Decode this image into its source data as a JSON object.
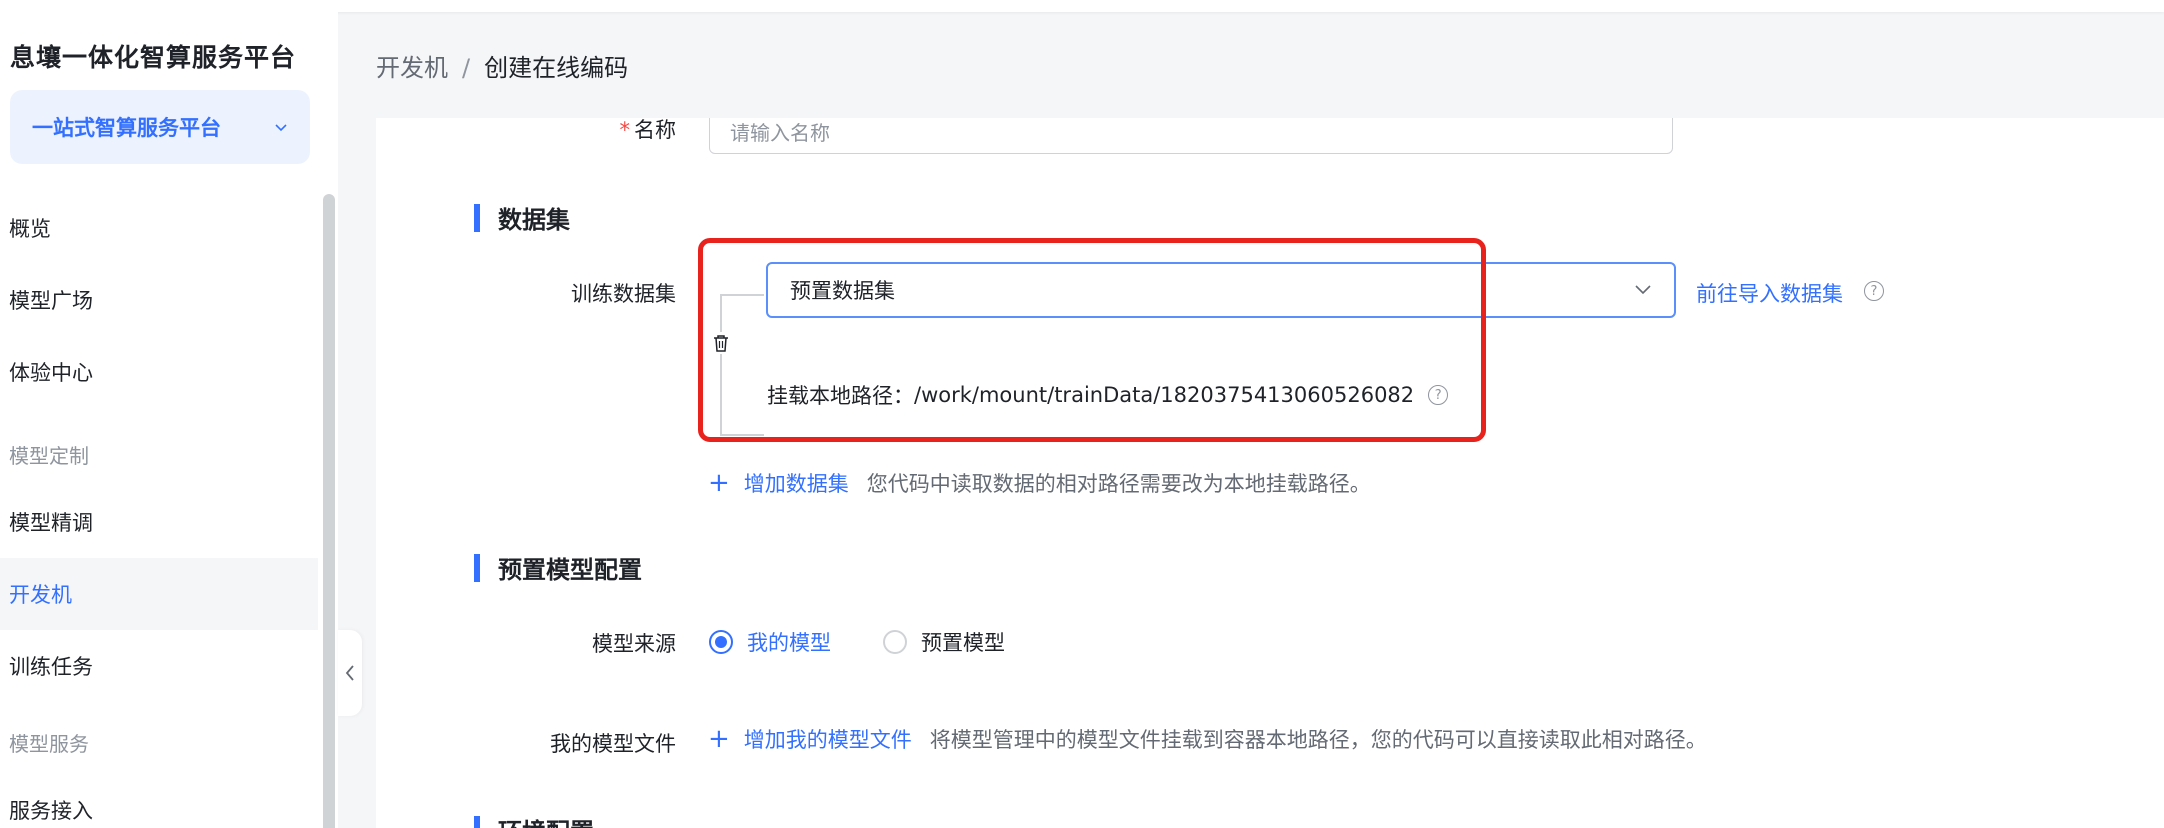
{
  "app": {
    "brand": "息壤一体化智算服务平台"
  },
  "sidebar": {
    "platform_select": "一站式智算服务平台",
    "items": [
      {
        "label": "概览"
      },
      {
        "label": "模型广场"
      },
      {
        "label": "体验中心"
      },
      {
        "label": "模型精调"
      },
      {
        "label": "开发机"
      },
      {
        "label": "训练任务"
      },
      {
        "label": "服务接入"
      }
    ],
    "groups": [
      "模型定制",
      "模型服务"
    ],
    "active": "开发机"
  },
  "breadcrumb": {
    "parent": "开发机",
    "separator": "/",
    "current": "创建在线编码"
  },
  "form": {
    "name": {
      "label": "名称",
      "required_mark": "*",
      "placeholder": "请输入名称"
    },
    "dataset_section": {
      "title": "数据集",
      "train_label": "训练数据集",
      "selected": "预置数据集",
      "goto_import": "前往导入数据集",
      "mount_path_label": "挂载本地路径：",
      "mount_path": "/work/mount/trainData/1820375413060526082",
      "add_dataset": "增加数据集",
      "add_hint": "您代码中读取数据的相对路径需要改为本地挂载路径。"
    },
    "model_section": {
      "title": "预置模型配置",
      "source_label": "模型来源",
      "options": [
        {
          "label": "我的模型",
          "checked": true
        },
        {
          "label": "预置模型",
          "checked": false
        }
      ],
      "files_label": "我的模型文件",
      "add_files": "增加我的模型文件",
      "files_hint": "将模型管理中的模型文件挂载到容器本地路径，您的代码可以直接读取此相对路径。"
    },
    "env_section": {
      "title": "环境配置"
    }
  },
  "colors": {
    "accent": "#3370ff",
    "highlight": "#e8231d"
  }
}
